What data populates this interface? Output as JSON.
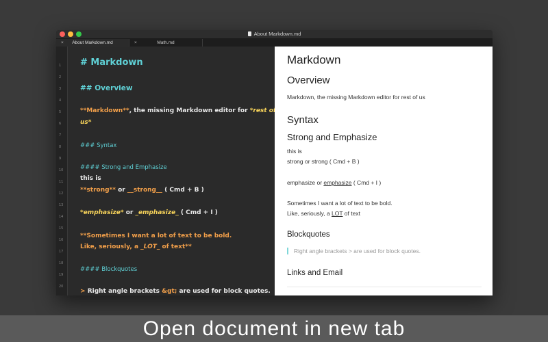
{
  "window": {
    "title": "About Markdown.md",
    "tabs": [
      {
        "label": "About Markdown.md",
        "close": "×"
      },
      {
        "label": "Math.md",
        "close": "×"
      }
    ]
  },
  "editor": {
    "line_numbers": [
      "1",
      "2",
      "3",
      "4",
      "5",
      "6",
      "7",
      "8",
      "9",
      "10",
      "11",
      "12",
      "13",
      "14",
      "15",
      "16",
      "17",
      "18",
      "19",
      "20"
    ],
    "h1": "# Markdown",
    "h2": "## Overview",
    "p1_a": "**Markdown**",
    "p1_b": ", the missing Markdown editor for ",
    "p1_c": "*rest of",
    "p1_d": "us*",
    "h3": "### Syntax",
    "h4": "#### Strong and Emphasize",
    "this_is": "this is",
    "strong_a": "**strong**",
    "strong_b": " or ",
    "strong_c": "__strong__",
    "strong_d": " ( Cmd + B )",
    "em_a": "*emphasize*",
    "em_b": " or ",
    "em_c": "_emphasize_",
    "em_d": " ( Cmd + I )",
    "bold_1": "**Sometimes I want a lot of text to be bold.",
    "bold_2a": "Like, seriously, a ",
    "bold_2b": "_LOT_",
    "bold_2c": " of text**",
    "h4_bq": "#### Blockquotes",
    "bq_a": "> ",
    "bq_b": "Right angle brackets ",
    "bq_c": "&gt;",
    "bq_d": " are used for block quotes."
  },
  "preview": {
    "h1": "Markdown",
    "h2": "Overview",
    "p1": "Markdown, the missing Markdown editor for rest of us",
    "h3": "Syntax",
    "h4": "Strong and Emphasize",
    "this_is": "this is",
    "strong_line": "strong or strong ( Cmd + B )",
    "em_a": "emphasize",
    "em_b": " or ",
    "em_c": "emphasize",
    "em_d": " ( Cmd + I )",
    "bold_1": "Sometimes I want a lot of text to be bold.",
    "bold_2a": "Like, seriously, a ",
    "bold_2b": "LOT",
    "bold_2c": " of text",
    "h4_bq": "Blockquotes",
    "bq": "Right angle brackets > are used for block quotes.",
    "h4_links": "Links and Email"
  },
  "caption": "Open document in new tab"
}
